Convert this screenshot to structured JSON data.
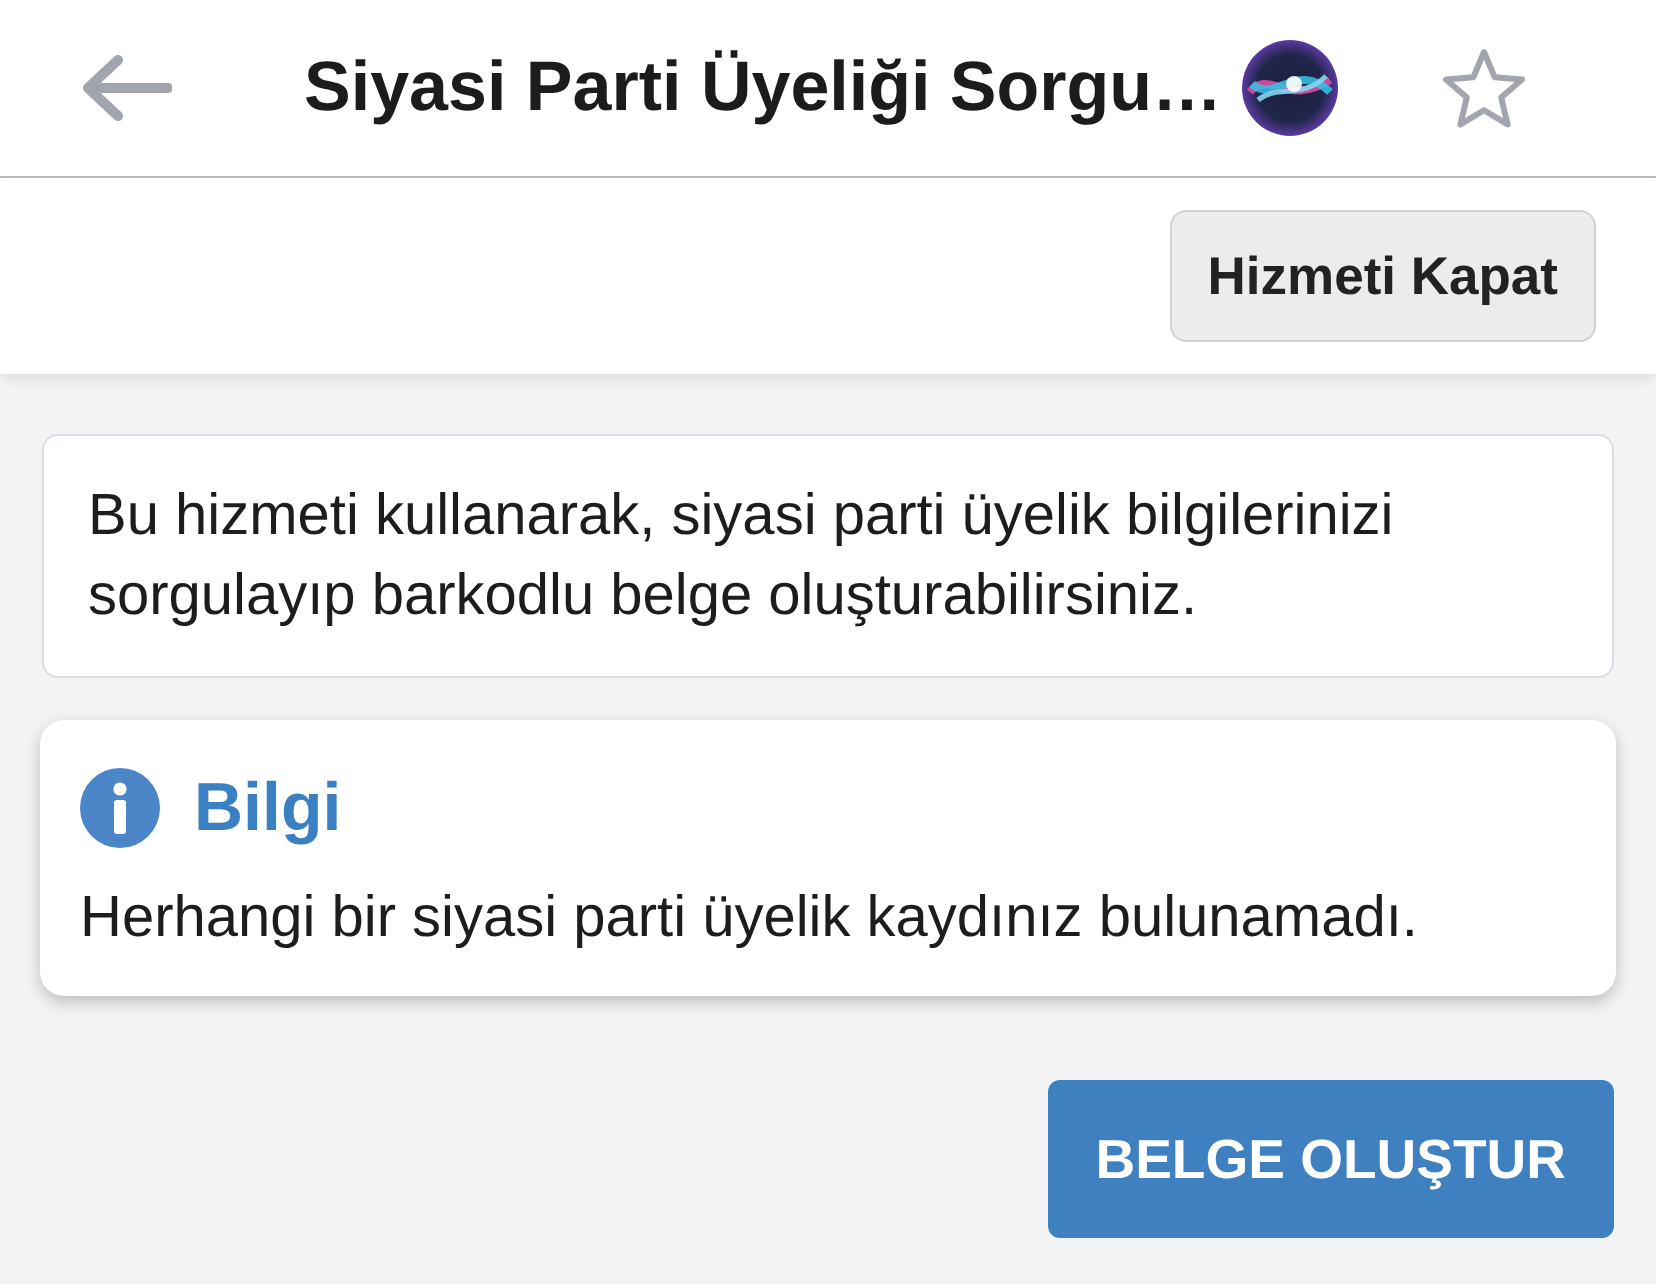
{
  "header": {
    "title": "Siyasi Parti Üyeliği Sorgu…",
    "favorite": false
  },
  "toolbar": {
    "close_button": "Hizmeti Kapat"
  },
  "description": "Bu hizmeti kullanarak, siyasi parti üyelik bilgilerinizi sorgulayıp barkodlu belge oluşturabilirsiniz.",
  "info": {
    "title": "Bilgi",
    "message": "Herhangi bir siyasi parti üyelik kaydınız bulunamadı."
  },
  "primary_button": "BELGE OLUŞTUR"
}
